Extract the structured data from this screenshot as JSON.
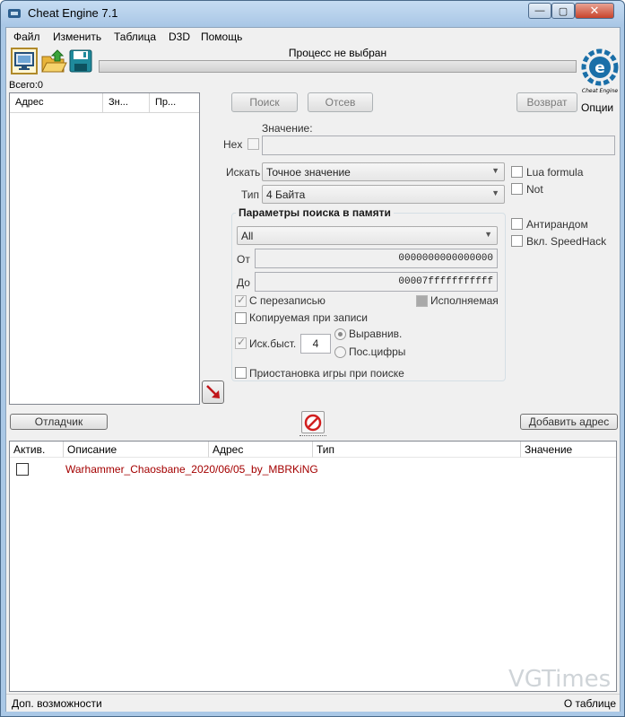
{
  "window": {
    "title": "Cheat Engine 7.1",
    "minimize_glyph": "—",
    "maximize_glyph": "▢",
    "close_glyph": "✕"
  },
  "menu": [
    "Файл",
    "Изменить",
    "Таблица",
    "D3D",
    "Помощь"
  ],
  "toolbar": {
    "icons": [
      "open-process-icon",
      "open-file-icon",
      "save-file-icon"
    ],
    "process_label": "Процесс не выбран",
    "options_label": "Опции",
    "logo_text": "Cheat Engine"
  },
  "found": {
    "label": "Всего:0",
    "columns": [
      "Адрес",
      "Зн...",
      "Пр..."
    ]
  },
  "scan": {
    "first_scan": "Поиск",
    "next_scan": "Отсев",
    "undo_scan": "Возврат",
    "value_label": "Значение:",
    "hex_label": "Hex",
    "scan_type_label": "Искать",
    "scan_type_value": "Точное значение",
    "value_type_label": "Тип",
    "value_type_value": "4 Байта",
    "lua_formula": "Lua formula",
    "not_label": "Not",
    "antirandom": "Антирандом",
    "speedhack": "Вкл. SpeedHack"
  },
  "memory": {
    "title": "Параметры поиска в памяти",
    "region": "All",
    "from_label": "От",
    "from_value": "0000000000000000",
    "to_label": "До",
    "to_value": "00007fffffffffff",
    "writable": "С перезаписью",
    "executable": "Исполняемая",
    "copy_on_write": "Копируемая при записи",
    "fast_scan": "Иск.быст.",
    "fast_scan_value": "4",
    "alignment": "Выравнив.",
    "last_digits": "Пос.цифры",
    "pause_game": "Приостановка игры при поиске"
  },
  "actions": {
    "debugger": "Отладчик",
    "add_address": "Добавить адрес"
  },
  "table": {
    "columns": [
      "Актив.",
      "Описание",
      "Адрес",
      "Тип",
      "Значение"
    ],
    "rows": [
      {
        "description": "Warhammer_Chaosbane_2020/06/05_by_MBRKiNG"
      }
    ]
  },
  "watermark": {
    "text": "VGTimes"
  },
  "status": {
    "left": "Доп. возможности",
    "right": "О таблице"
  },
  "colors": {
    "accent": "#aac8e6",
    "row_text": "#a40000",
    "logo": "#1a6fa8"
  }
}
